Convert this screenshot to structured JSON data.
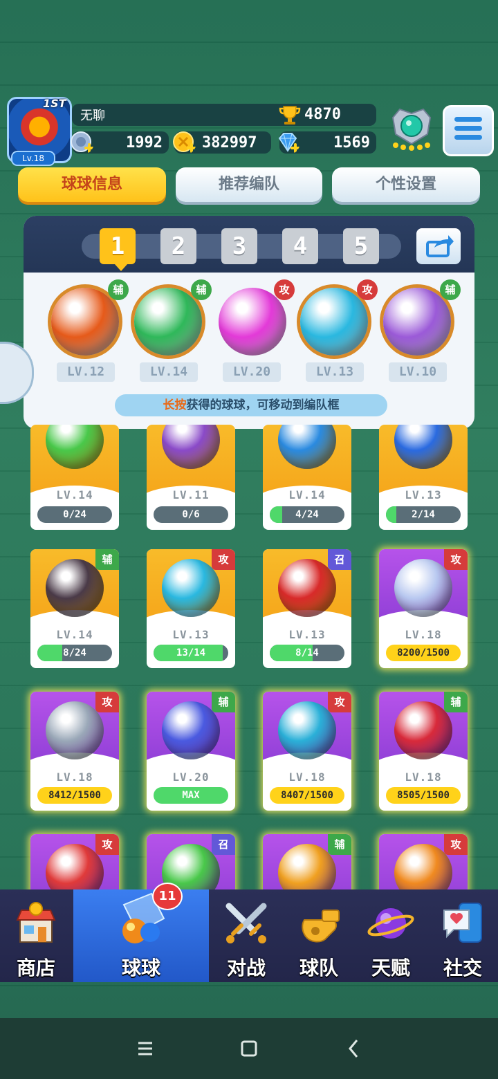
{
  "profile": {
    "rank_label": "1ST",
    "level": "Lv.18",
    "name": "无聊",
    "trophies": "4870"
  },
  "resources": {
    "stamina": "1992",
    "coins": "382997",
    "gems": "1569"
  },
  "tabs": [
    {
      "label": "球球信息",
      "active": true
    },
    {
      "label": "推荐编队",
      "active": false
    },
    {
      "label": "个性设置",
      "active": false
    }
  ],
  "team": {
    "slots": [
      "1",
      "2",
      "3",
      "4",
      "5"
    ],
    "active_slot": "1",
    "balls": [
      {
        "tag": "辅",
        "level": "LV.12",
        "color": "#e65a1a"
      },
      {
        "tag": "辅",
        "level": "LV.14",
        "color": "#2fb85a"
      },
      {
        "tag": "攻",
        "level": "LV.20",
        "color": "#e33ad8"
      },
      {
        "tag": "攻",
        "level": "LV.13",
        "color": "#2ab8e0"
      },
      {
        "tag": "辅",
        "level": "LV.10",
        "color": "#9b5ad8"
      }
    ],
    "hint_highlight": "长按",
    "hint_text": "获得的球球，可移动到编队框"
  },
  "cards": [
    {
      "style": "gold",
      "tag": "",
      "level": "LV.14",
      "progress": "0/24",
      "fill": 0,
      "color": "#49c84a"
    },
    {
      "style": "gold",
      "tag": "",
      "level": "LV.11",
      "progress": "0/6",
      "fill": 0,
      "color": "#8a4ac8"
    },
    {
      "style": "gold",
      "tag": "",
      "level": "LV.14",
      "progress": "4/24",
      "fill": 0.17,
      "color": "#2a8ae0"
    },
    {
      "style": "gold",
      "tag": "",
      "level": "LV.13",
      "progress": "2/14",
      "fill": 0.14,
      "color": "#2a6ae0"
    },
    {
      "style": "gold",
      "tag": "辅",
      "level": "LV.14",
      "progress": "8/24",
      "fill": 0.33,
      "color": "#4a3a48"
    },
    {
      "style": "gold",
      "tag": "攻",
      "level": "LV.13",
      "progress": "13/14",
      "fill": 0.93,
      "color": "#2ab8e0"
    },
    {
      "style": "gold",
      "tag": "召",
      "level": "LV.13",
      "progress": "8/14",
      "fill": 0.57,
      "color": "#d82a2a"
    },
    {
      "style": "purple",
      "tag": "攻",
      "level": "LV.18",
      "progress": "8200/1500",
      "fill": 1,
      "color": "#b8c8f0"
    },
    {
      "style": "purple",
      "tag": "攻",
      "level": "LV.18",
      "progress": "8412/1500",
      "fill": 1,
      "color": "#9aa8b8"
    },
    {
      "style": "purple",
      "tag": "辅",
      "level": "LV.20",
      "progress": "MAX",
      "fill": 1,
      "color": "#4a5ae0"
    },
    {
      "style": "purple",
      "tag": "攻",
      "level": "LV.18",
      "progress": "8407/1500",
      "fill": 1,
      "color": "#2ab0d8"
    },
    {
      "style": "purple",
      "tag": "辅",
      "level": "LV.18",
      "progress": "8505/1500",
      "fill": 1,
      "color": "#d82a3a"
    },
    {
      "style": "purple",
      "tag": "攻",
      "level": "",
      "progress": "",
      "fill": 0,
      "color": "#e03a3a"
    },
    {
      "style": "purple",
      "tag": "召",
      "level": "",
      "progress": "",
      "fill": 0,
      "color": "#49c84a"
    },
    {
      "style": "purple",
      "tag": "辅",
      "level": "",
      "progress": "",
      "fill": 0,
      "color": "#f0a020"
    },
    {
      "style": "purple",
      "tag": "攻",
      "level": "",
      "progress": "",
      "fill": 0,
      "color": "#f08a20"
    }
  ],
  "nav": {
    "items": [
      {
        "label": "商店",
        "icon": "shop-icon"
      },
      {
        "label": "球球",
        "icon": "balls-icon",
        "active": true
      },
      {
        "label": "对战",
        "icon": "swords-icon"
      },
      {
        "label": "球队",
        "icon": "whistle-icon"
      },
      {
        "label": "天赋",
        "icon": "planet-icon"
      },
      {
        "label": "社交",
        "icon": "chat-phone-icon"
      }
    ],
    "badge": "11"
  }
}
